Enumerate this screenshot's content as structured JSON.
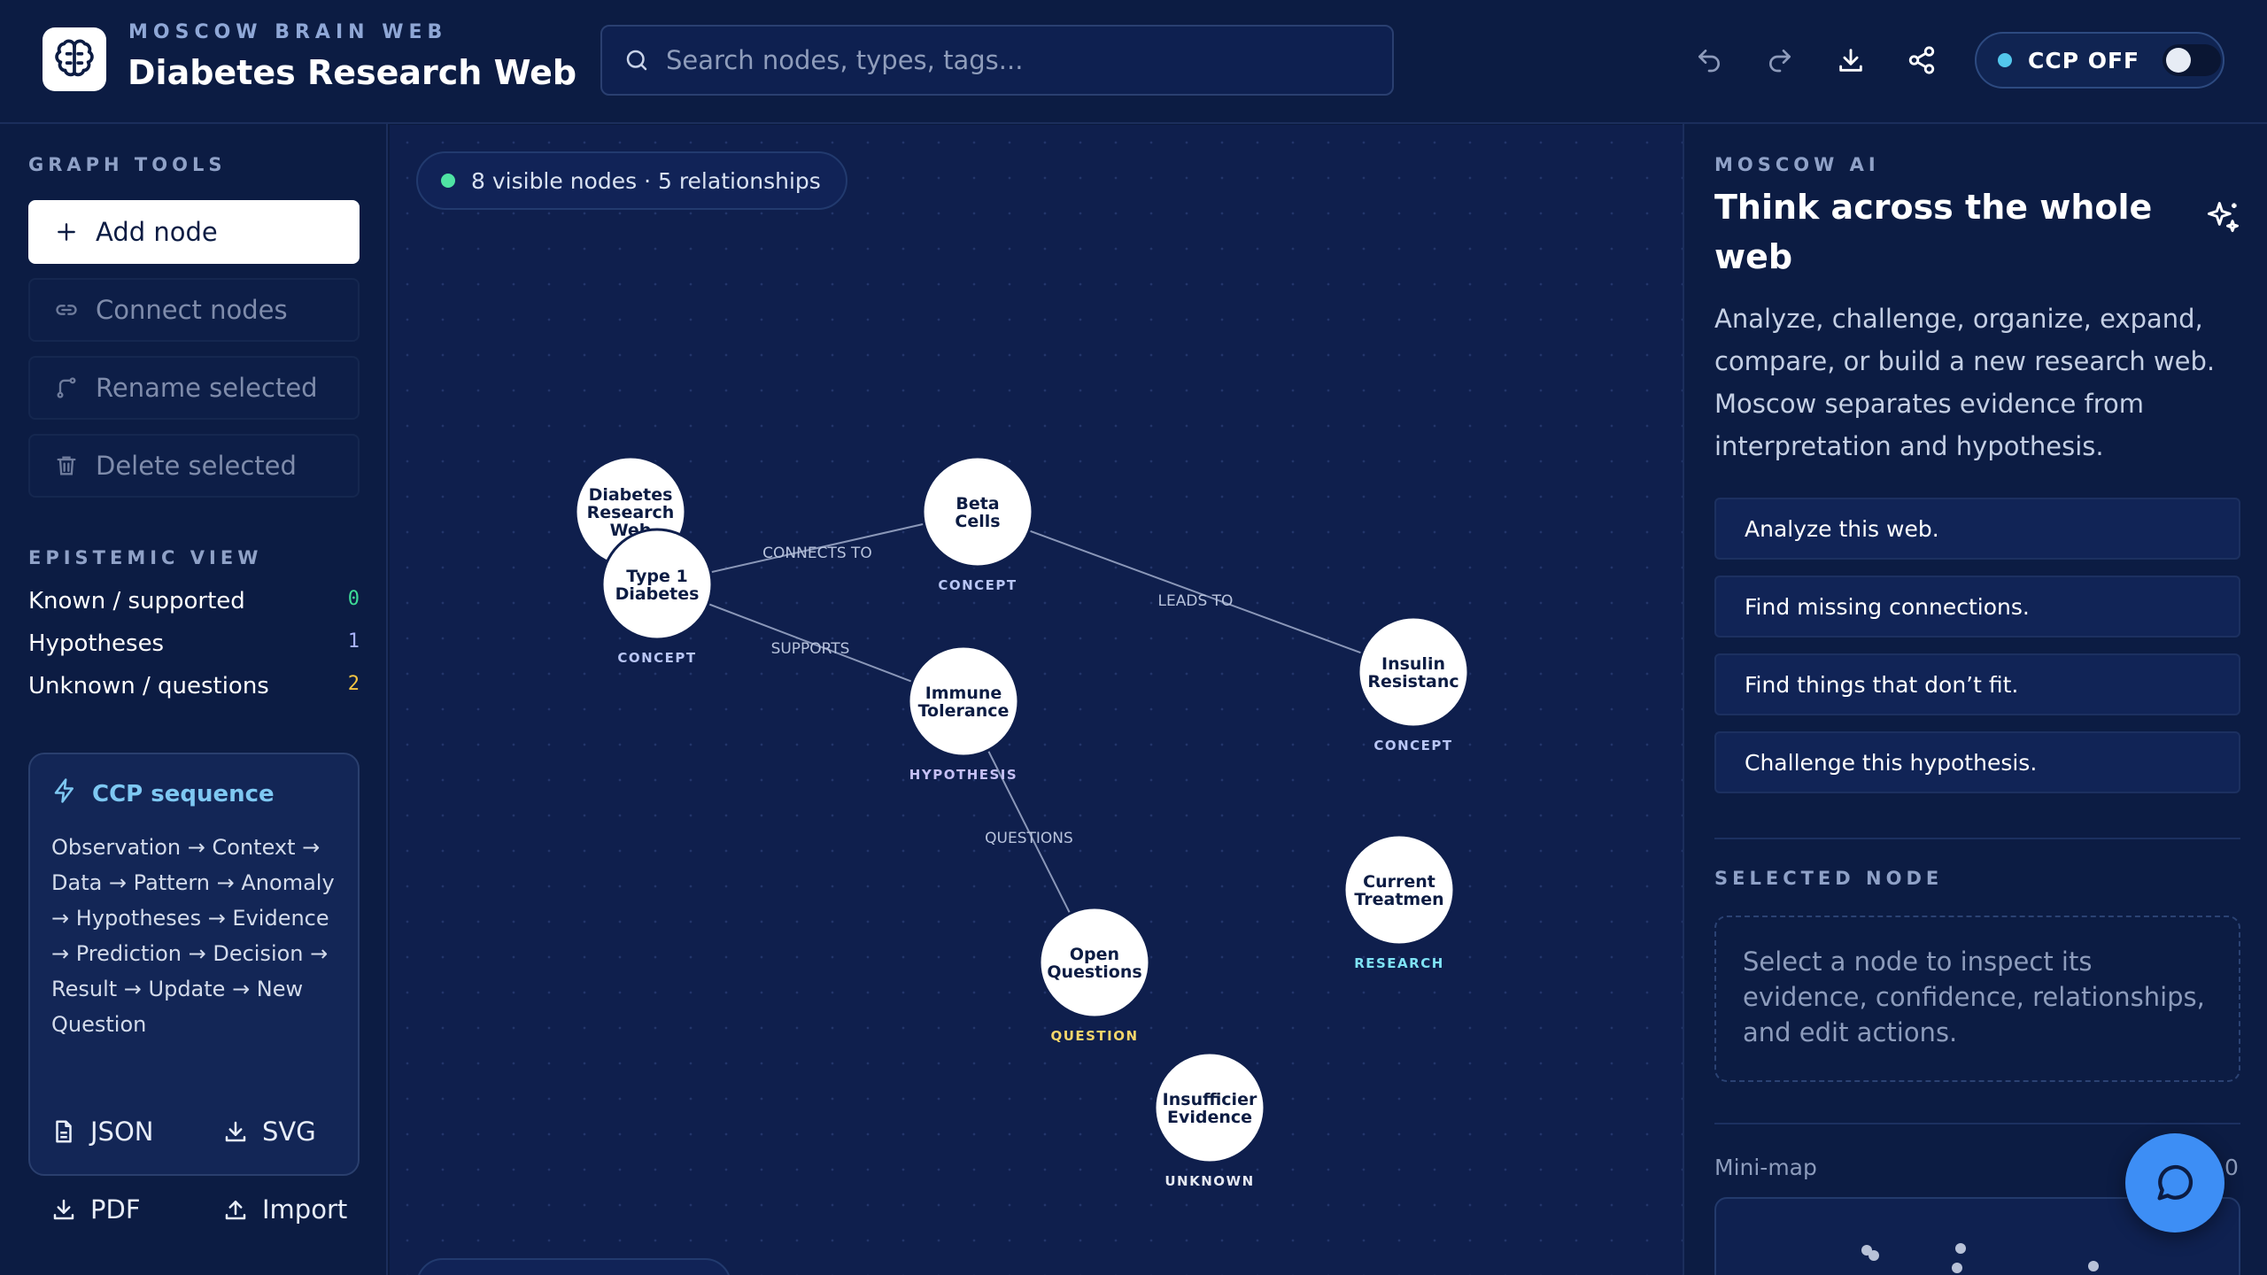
{
  "header": {
    "eyebrow": "MOSCOW BRAIN WEB",
    "title": "Diabetes Research Web",
    "search_placeholder": "Search nodes, types, tags...",
    "ccp_label": "CCP OFF",
    "ccp_on": false,
    "icons": [
      "undo-icon",
      "redo-icon",
      "download-icon",
      "share-icon"
    ]
  },
  "sidebar": {
    "tools_label": "GRAPH TOOLS",
    "tools": [
      {
        "label": "Add node",
        "icon": "plus-icon"
      },
      {
        "label": "Connect nodes",
        "icon": "link-icon"
      },
      {
        "label": "Rename selected",
        "icon": "branch-icon"
      },
      {
        "label": "Delete selected",
        "icon": "trash-icon"
      }
    ],
    "epistemic_label": "EPISTEMIC VIEW",
    "epistemic": [
      {
        "label": "Known / supported",
        "count": "0",
        "color": "#3ddc97"
      },
      {
        "label": "Hypotheses",
        "count": "1",
        "color": "#a9b4ff"
      },
      {
        "label": "Unknown / questions",
        "count": "2",
        "color": "#f5c542"
      }
    ],
    "ccp_card": {
      "title": "CCP sequence",
      "body": "Observation → Context → Data → Pattern → Anomaly → Hypotheses → Evidence → Prediction → Decision → Result → Update → New Question"
    },
    "exports": [
      {
        "label": "JSON",
        "icon": "file-icon"
      },
      {
        "label": "SVG",
        "icon": "download-icon"
      },
      {
        "label": "PDF",
        "icon": "download-icon"
      },
      {
        "label": "Import",
        "icon": "upload-icon"
      }
    ]
  },
  "canvas": {
    "status": "8 visible nodes · 5 relationships",
    "type_colors": {
      "CONCEPT": "#b9c6f5",
      "HYPOTHESIS": "#c6c0f5",
      "QUESTION": "#f5d66b",
      "RESEARCH": "#7fe3f5",
      "UNKNOWN": "#e6e9f2"
    },
    "nodes": [
      {
        "id": "diabetes-research-web",
        "label": [
          "Diabetes",
          "Research",
          "Web"
        ],
        "type": ""
      },
      {
        "id": "type-1-diabetes",
        "label": [
          "Type 1",
          "Diabetes"
        ],
        "type": "CONCEPT"
      },
      {
        "id": "beta-cells",
        "label": [
          "Beta",
          "Cells"
        ],
        "type": "CONCEPT"
      },
      {
        "id": "immune-tolerance",
        "label": [
          "Immune",
          "Tolerance"
        ],
        "type": "HYPOTHESIS"
      },
      {
        "id": "insulin-resistance",
        "label": [
          "Insulin",
          "Resistanc"
        ],
        "type": "CONCEPT"
      },
      {
        "id": "current-treatments",
        "label": [
          "Current",
          "Treatmen"
        ],
        "type": "RESEARCH"
      },
      {
        "id": "open-questions",
        "label": [
          "Open",
          "Questions"
        ],
        "type": "QUESTION"
      },
      {
        "id": "insufficient-evidence",
        "label": [
          "Insufficier",
          "Evidence"
        ],
        "type": "UNKNOWN"
      }
    ],
    "edges": [
      {
        "from": "type-1-diabetes",
        "to": "beta-cells",
        "label": "CONNECTS TO"
      },
      {
        "from": "beta-cells",
        "to": "insulin-resistance",
        "label": "LEADS TO"
      },
      {
        "from": "type-1-diabetes",
        "to": "immune-tolerance",
        "label": "SUPPORTS"
      },
      {
        "from": "immune-tolerance",
        "to": "open-questions",
        "label": "QUESTIONS"
      }
    ]
  },
  "ai_panel": {
    "eyebrow": "MOSCOW AI",
    "title": "Think across the whole web",
    "description": "Analyze, challenge, organize, expand, compare, or build a new research web. Moscow separates evidence from interpretation and hypothesis.",
    "prompts": [
      "Analyze this web.",
      "Find missing connections.",
      "Find things that don’t fit.",
      "Challenge this hypothesis."
    ],
    "selected_label": "SELECTED NODE",
    "selected_placeholder": "Select a node to inspect its evidence, confidence, relationships, and edit actions.",
    "minimap_label": "Mini-map",
    "minimap_zoom": "0"
  }
}
